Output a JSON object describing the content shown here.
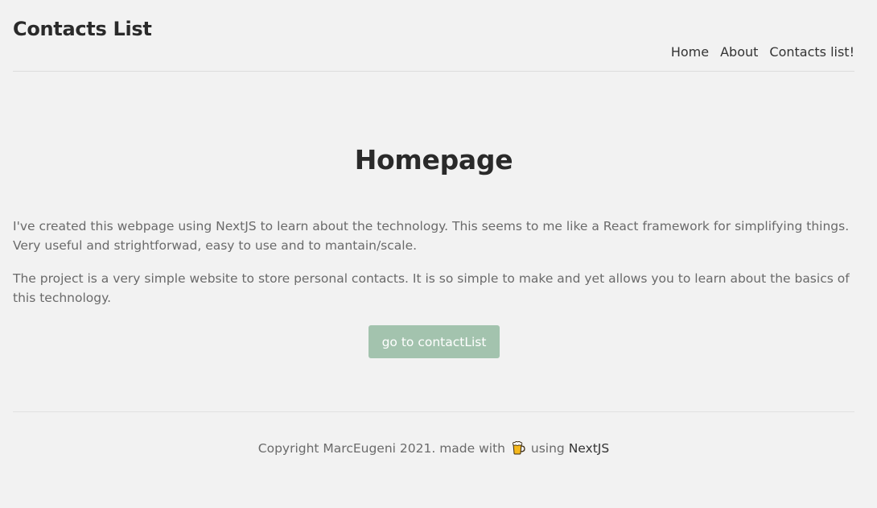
{
  "header": {
    "title": "Contacts List",
    "nav": [
      {
        "label": "Home"
      },
      {
        "label": "About"
      },
      {
        "label": "Contacts list!"
      }
    ]
  },
  "main": {
    "heading": "Homepage",
    "paragraphs": [
      "I've created this webpage using NextJS to learn about the technology. This seems to me like a React framework for simplifying things. Very useful and strightforwad, easy to use and to mantain/scale.",
      "The project is a very simple website to store personal contacts. It is so simple to make and yet allows you to learn about the basics of this technology."
    ],
    "cta_label": "go to contactList",
    "cta_color": "#a3c3ae"
  },
  "footer": {
    "prefix": "Copyright MarcEugeni 2021. made with",
    "icon": "beer-icon",
    "middle": "using",
    "link": "NextJS"
  },
  "colors": {
    "background": "#f2f2f2",
    "text_dark": "#2a2a2a",
    "text_muted": "#6a6a6a",
    "divider": "#dcdcdc"
  }
}
